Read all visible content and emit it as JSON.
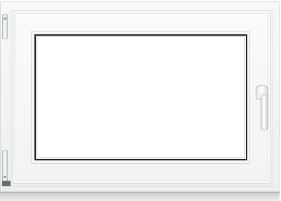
{
  "image": {
    "subject": "window",
    "colors": {
      "frame": "#f4f5f5",
      "glass_border": "#1e1f20",
      "glass": "#ffffff",
      "sill": "#d8d8d8",
      "hardware": "#ffffff"
    },
    "icons": [
      "hinge-icon",
      "window-handle-icon"
    ]
  }
}
